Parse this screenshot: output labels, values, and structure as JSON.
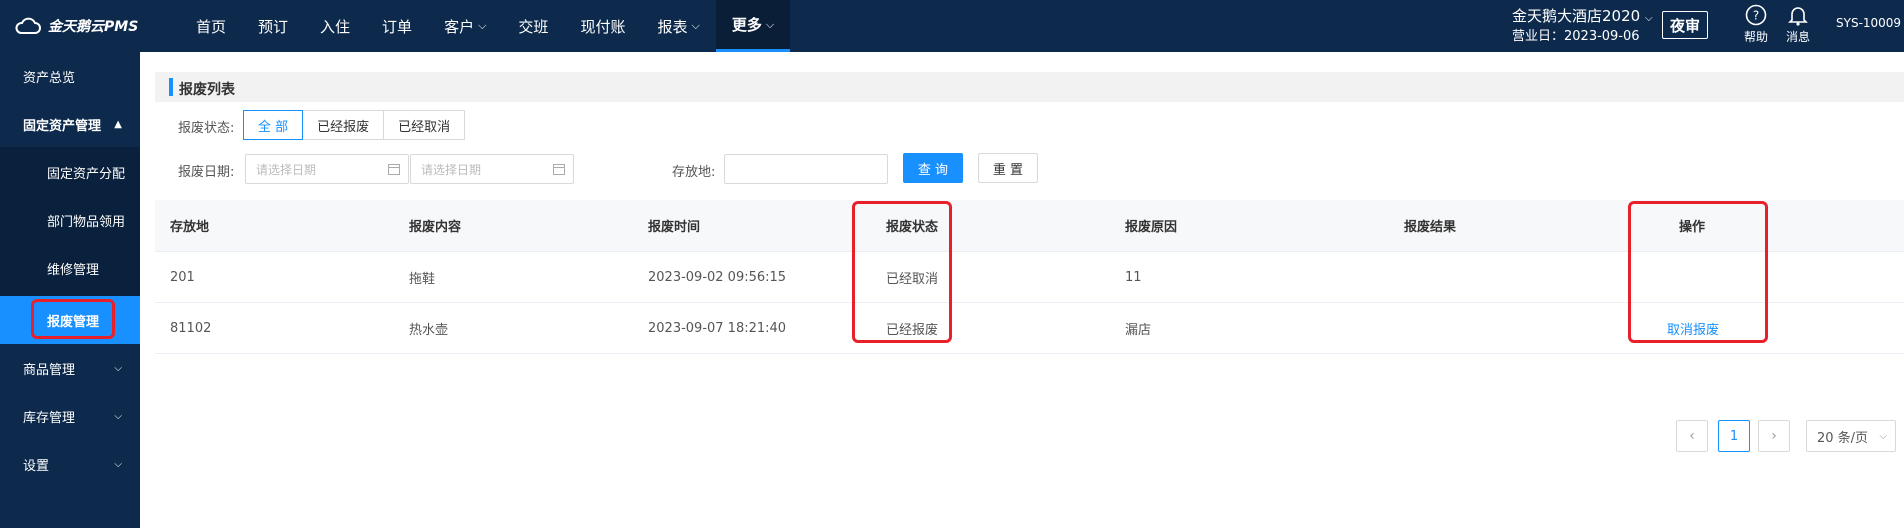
{
  "app": {
    "logo_text": "金天鹅云PMS"
  },
  "nav": [
    {
      "label": "首页",
      "has_caret": false,
      "active": false
    },
    {
      "label": "预订",
      "has_caret": false,
      "active": false
    },
    {
      "label": "入住",
      "has_caret": false,
      "active": false
    },
    {
      "label": "订单",
      "has_caret": false,
      "active": false
    },
    {
      "label": "客户",
      "has_caret": true,
      "active": false
    },
    {
      "label": "交班",
      "has_caret": false,
      "active": false
    },
    {
      "label": "现付账",
      "has_caret": false,
      "active": false
    },
    {
      "label": "报表",
      "has_caret": true,
      "active": false
    },
    {
      "label": "更多",
      "has_caret": true,
      "active": true
    }
  ],
  "header": {
    "hotel_name": "金天鹅大酒店2020",
    "business_day": "营业日：2023-09-06",
    "night_audit": "夜审",
    "help_label": "帮助",
    "message_label": "消息",
    "user": "SYS-10009"
  },
  "sidebar": {
    "items": [
      {
        "label": "资产总览"
      },
      {
        "label": "固定资产管理"
      },
      {
        "label": "固定资产分配"
      },
      {
        "label": "部门物品领用"
      },
      {
        "label": "维修管理"
      },
      {
        "label": "报废管理"
      },
      {
        "label": "商品管理"
      },
      {
        "label": "库存管理"
      },
      {
        "label": "设置"
      }
    ]
  },
  "page": {
    "title": "报废列表"
  },
  "filters": {
    "status_label": "报废状态:",
    "status_options": [
      "全 部",
      "已经报废",
      "已经取消"
    ],
    "date_label": "报废日期:",
    "date_start_placeholder": "请选择日期",
    "date_end_placeholder": "请选择日期",
    "location_label": "存放地:",
    "query_button": "查 询",
    "reset_button": "重 置"
  },
  "table": {
    "columns": [
      "存放地",
      "报废内容",
      "报废时间",
      "报废状态",
      "报废原因",
      "报废结果",
      "操作"
    ],
    "rows": [
      {
        "location": "201",
        "content": "拖鞋",
        "time": "2023-09-02 09:56:15",
        "status": "已经取消",
        "reason": "11",
        "result": "",
        "action": ""
      },
      {
        "location": "81102",
        "content": "热水壶",
        "time": "2023-09-07 18:21:40",
        "status": "已经报废",
        "reason": "漏店",
        "result": "",
        "action": "取消报废"
      }
    ]
  },
  "pagination": {
    "prev": "‹",
    "current": "1",
    "next": "›",
    "page_size": "20 条/页"
  },
  "colors": {
    "topbar": "#0d2a4c",
    "accent": "#1890ff",
    "highlight": "#e8202a"
  }
}
